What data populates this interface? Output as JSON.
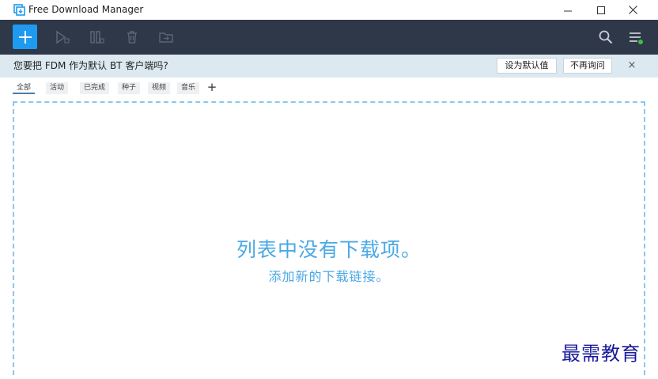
{
  "window": {
    "title": "Free Download Manager"
  },
  "toolbar": {
    "icons": [
      "add-download-icon",
      "start-icon",
      "pause-icon",
      "delete-icon",
      "move-folder-icon",
      "search-icon",
      "menu-icon"
    ]
  },
  "banner": {
    "message": "您要把 FDM 作为默认 BT 客户端吗?",
    "set_default_label": "设为默认值",
    "never_ask_label": "不再询问",
    "close_glyph": "×"
  },
  "tabs": [
    {
      "label": "全部",
      "active": true
    },
    {
      "label": "活动",
      "active": false
    },
    {
      "label": "已完成",
      "active": false
    },
    {
      "label": "种子",
      "active": false
    },
    {
      "label": "视频",
      "active": false
    },
    {
      "label": "音乐",
      "active": false
    }
  ],
  "tab_add_glyph": "+",
  "empty_state": {
    "title": "列表中没有下载项。",
    "subtitle": "添加新的下载链接。"
  },
  "watermark": "最需教育",
  "colors": {
    "toolbar_bg": "#2f3848",
    "accent": "#1e9bf0",
    "banner_bg": "#dce9f1",
    "empty_text": "#4aa8e6",
    "status_dot": "#3cc03c"
  }
}
